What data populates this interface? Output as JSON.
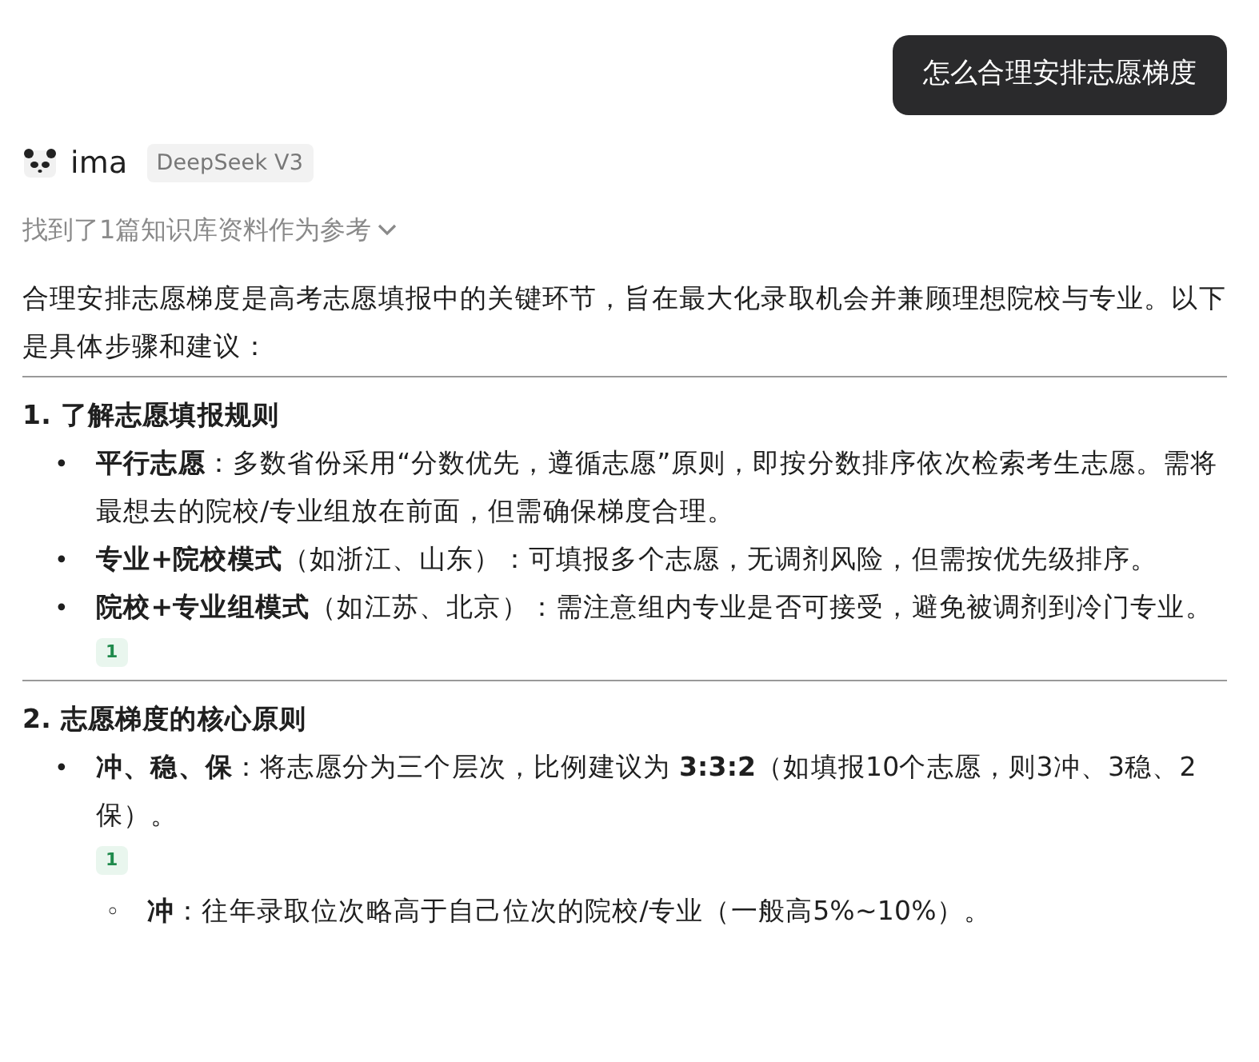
{
  "user_message": {
    "text": "怎么合理安排志愿梯度"
  },
  "assistant": {
    "name": "ima",
    "model": "DeepSeek V3"
  },
  "references": {
    "text": "找到了1篇知识库资料作为参考",
    "expanded": false
  },
  "content": [
    {
      "kind": "paragraph",
      "text": "合理安排志愿梯度是高考志愿填报中的关键环节，旨在最大化录取机会并兼顾理想院校与专业。以下是具体步骤和建议："
    },
    {
      "kind": "divider"
    },
    {
      "kind": "heading",
      "text": "1. 了解志愿填报规则"
    },
    {
      "kind": "list",
      "items": [
        {
          "marker": "•",
          "text": "**平行志愿**：多数省份采用“分数优先，遵循志愿”原则，即按分数排序依次检索考生志愿。需将最想去的院校/专业组放在前面，但需确保梯度合理。"
        },
        {
          "marker": "•",
          "text": "**专业+院校模式**（如浙江、山东）：可填报多个志愿，无调剂风险，但需按优先级排序。"
        },
        {
          "marker": "•",
          "text": "**院校+专业组模式**（如江苏、北京）：需注意组内专业是否可接受，避免被调剂到冷门专业。",
          "citation": "1"
        }
      ]
    },
    {
      "kind": "divider"
    },
    {
      "kind": "heading",
      "text": "2. 志愿梯度的核心原则"
    },
    {
      "kind": "list",
      "items": [
        {
          "marker": "•",
          "text": "**冲、稳、保**：将志愿分为三个层次，比例建议为 **3:3:2**（如填报10个志愿，则3冲、3稳、2保）。",
          "citation": "1",
          "children": [
            {
              "marker": "◦",
              "text": "**冲**：往年录取位次略高于自己位次的院校/专业（一般高5%~10%）。"
            }
          ]
        }
      ]
    }
  ]
}
